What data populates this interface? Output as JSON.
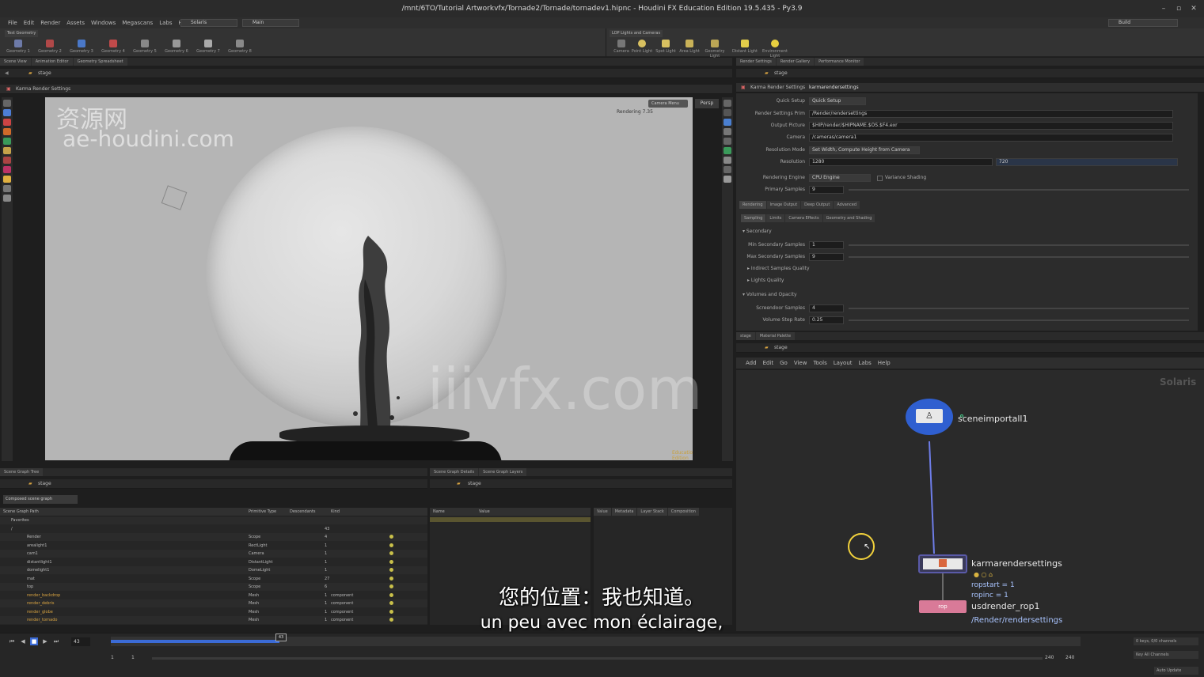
{
  "window": {
    "title": "/mnt/6TO/Tutorial Artworkvfx/Tornade2/Tornade/tornadev1.hipnc - Houdini FX Education Edition 19.5.435 - Py3.9",
    "controls": [
      "–",
      "▫",
      "✕"
    ]
  },
  "menubar": {
    "items": [
      "File",
      "Edit",
      "Render",
      "Assets",
      "Windows",
      "Megascans",
      "Labs",
      "Help"
    ],
    "desktop": "Solaris",
    "context": "Main",
    "build": "Build"
  },
  "shelf": {
    "left_tab": "Test Geometry",
    "left_tools": [
      "Geometry 1",
      "Geometry 2",
      "Geometry 3",
      "Geometry 4",
      "Geometry 5",
      "Geometry 6",
      "Geometry 7",
      "Geometry 8"
    ],
    "right_tab": "LOP Lights and Cameras",
    "right_tools": [
      "Camera",
      "Point Light",
      "Spot Light",
      "Area Light",
      "Geometry Light",
      "Distant Light",
      "Environment Light"
    ]
  },
  "left_panel": {
    "tabs": [
      "Scene View",
      "Animation Editor",
      "Geometry Spreadsheet"
    ],
    "path": "stage",
    "viewer_title": "Karma Render Settings",
    "render_info": "Rendering",
    "render_time": "7.35",
    "camera_menu": "Camera Menu",
    "persp": "Persp",
    "edition_badge": "Education Edition"
  },
  "params": {
    "tabs": [
      "Render Settings",
      "Render Gallery",
      "Performance Monitor"
    ],
    "path": "stage",
    "node_type": "Karma Render Settings",
    "node_name": "karmarendersettings",
    "rows": [
      {
        "label": "Quick Setup",
        "value": "Quick Setup"
      },
      {
        "label": "Render Settings Prim",
        "value": "/Render/rendersettings"
      },
      {
        "label": "Output Picture",
        "value": "$HIP/render/$HIPNAME.$OS.$F4.exr"
      },
      {
        "label": "Camera",
        "value": "/cameras/camera1"
      },
      {
        "label": "Resolution Mode",
        "value": "Set Width, Compute Height from Camera"
      },
      {
        "label": "Resolution",
        "value": "1280",
        "value2": "720"
      },
      {
        "label": "Rendering Engine",
        "value": "CPU Engine",
        "extra": "Variance Shading"
      },
      {
        "label": "Primary Samples",
        "value": "9"
      }
    ],
    "main_tabs": [
      "Rendering",
      "Image Output",
      "Deep Output",
      "Advanced"
    ],
    "sub_tabs": [
      "Sampling",
      "Limits",
      "Camera Effects",
      "Geometry and Shading"
    ],
    "secondary_section": "Secondary",
    "secondary_rows": [
      {
        "label": "Min Secondary Samples",
        "value": "1"
      },
      {
        "label": "Max Secondary Samples",
        "value": "9"
      }
    ],
    "collapsed_sections": [
      "Indirect Samples Quality",
      "Lights Quality"
    ],
    "volume_section": "Volumes and Opacity",
    "volume_rows": [
      {
        "label": "Screendoor Samples",
        "value": "4"
      },
      {
        "label": "Volume Step Rate",
        "value": "0.25"
      }
    ]
  },
  "network": {
    "tabs": [
      "stage",
      "Material Palette"
    ],
    "path": "stage",
    "menu": [
      "Add",
      "Edit",
      "Go",
      "View",
      "Tools",
      "Layout",
      "Labs",
      "Help"
    ],
    "context_label": "Solaris",
    "node1": {
      "name": "sceneimportall1"
    },
    "node2": {
      "name": "karmarendersettings",
      "info1": "ropstart = 1",
      "info2": "ropinc = 1",
      "info3": "usdrender_rop1",
      "info4": "/Render/rendersettings"
    },
    "node3": {
      "name": "rop"
    }
  },
  "scene_tree": {
    "tabs": [
      "Scene Graph Tree"
    ],
    "path": "stage",
    "filter": "Composed scene graph",
    "columns": [
      "Scene Graph Path",
      "Primitive Type",
      "Descendants",
      "Kind"
    ],
    "rows": [
      {
        "name": "Favorites",
        "type": "",
        "desc": "",
        "kind": ""
      },
      {
        "name": "/",
        "type": "",
        "desc": "43",
        "kind": ""
      },
      {
        "name": "Render",
        "type": "Scope",
        "desc": "4",
        "kind": ""
      },
      {
        "name": "arealight1",
        "type": "RectLight",
        "desc": "1",
        "kind": ""
      },
      {
        "name": "cam1",
        "type": "Camera",
        "desc": "1",
        "kind": ""
      },
      {
        "name": "distantlight1",
        "type": "DistantLight",
        "desc": "1",
        "kind": ""
      },
      {
        "name": "domelight1",
        "type": "DomeLight",
        "desc": "1",
        "kind": ""
      },
      {
        "name": "mat",
        "type": "Scope",
        "desc": "27",
        "kind": ""
      },
      {
        "name": "top",
        "type": "Scope",
        "desc": "6",
        "kind": ""
      },
      {
        "name": "render_backdrop",
        "type": "Mesh",
        "desc": "1",
        "kind": "component"
      },
      {
        "name": "render_debris",
        "type": "Mesh",
        "desc": "1",
        "kind": "component"
      },
      {
        "name": "render_globe",
        "type": "Mesh",
        "desc": "1",
        "kind": "component"
      },
      {
        "name": "render_tornado",
        "type": "Mesh",
        "desc": "1",
        "kind": "component"
      }
    ]
  },
  "scene_detail": {
    "tabs": [
      "Scene Graph Details",
      "Scene Graph Layers"
    ],
    "path": "stage",
    "columns": [
      "Name",
      "Value"
    ],
    "right_columns": [
      "Value",
      "Metadata",
      "Layer Stack",
      "Composition"
    ]
  },
  "timeline": {
    "frame": "43",
    "start": "1",
    "start2": "1",
    "end": "240",
    "end2": "240",
    "keys_label": "0 keys, 0/0 channels",
    "channels_label": "Key All Channels",
    "update": "Auto Update"
  },
  "subtitles": {
    "zh": "您的位置：我也知道。",
    "fr": "un peu avec mon éclairage,"
  },
  "watermarks": {
    "cn": "资源网",
    "site": "ae-houdini.com",
    "center": "iiivfx.com"
  },
  "colors": {
    "accent_blue": "#3b6bd6",
    "node_blue": "#2f5fd0",
    "rop_pink": "#d97a98",
    "cursor_ring": "#f2d23c"
  }
}
